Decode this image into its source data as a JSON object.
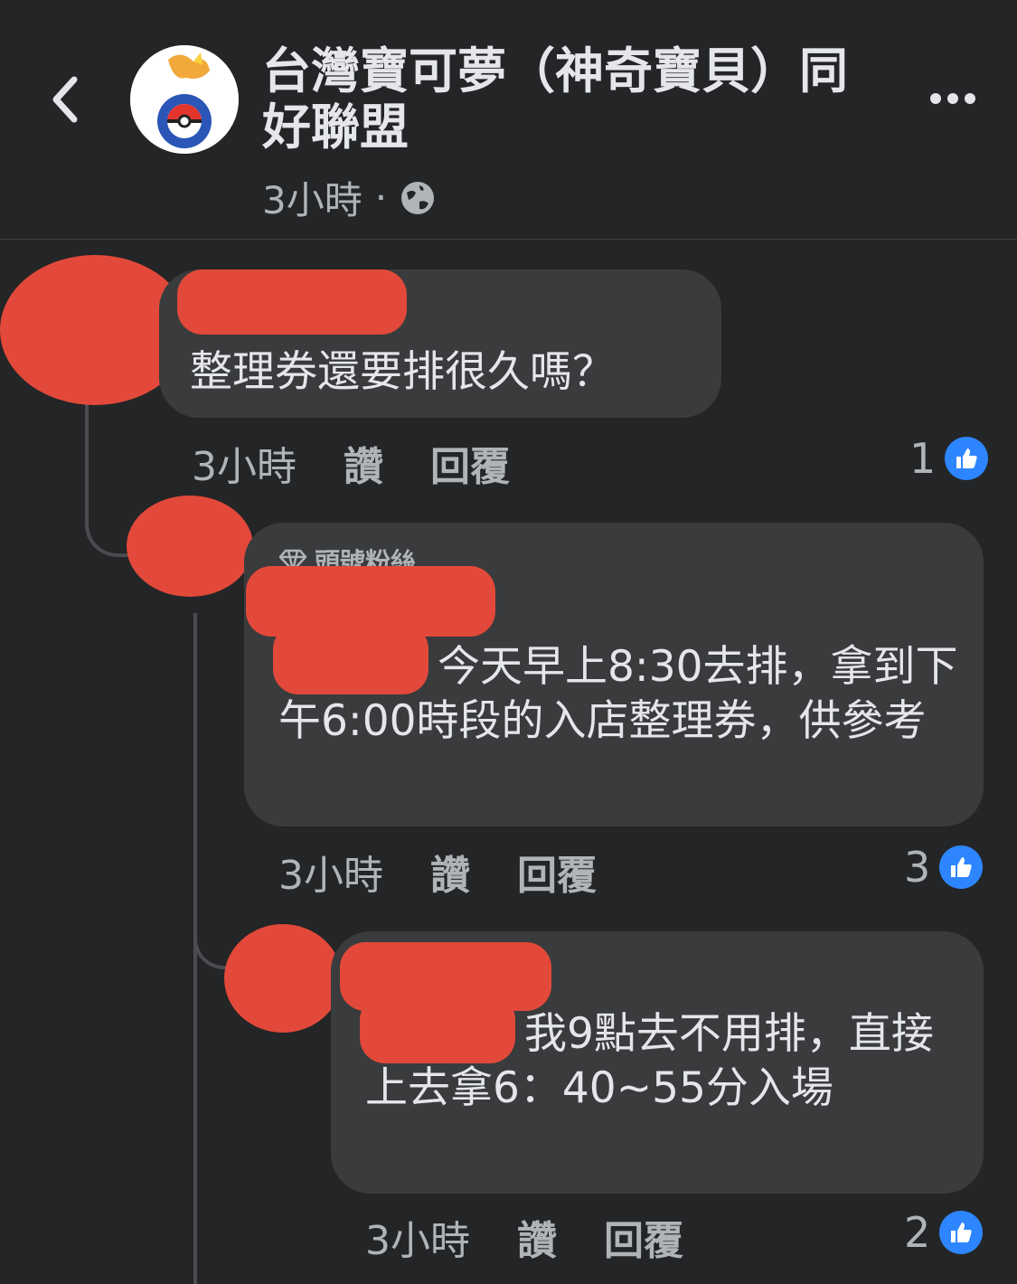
{
  "header": {
    "title": "台灣寶可夢（神奇寶貝）同好聯盟",
    "time": "3小時",
    "separator": "·",
    "back_icon": "chevron-left-icon",
    "privacy_icon": "globe-icon",
    "more_icon": "more-horizontal-icon"
  },
  "comments": [
    {
      "text": "整理券還要排很久嗎？",
      "time": "3小時",
      "like_label": "讚",
      "reply_label": "回覆",
      "likes": "1"
    },
    {
      "badge": "頭號粉絲",
      "text": "今天早上8:30去排，拿到下午6:00時段的入店整理券，供參考",
      "time": "3小時",
      "like_label": "讚",
      "reply_label": "回覆",
      "likes": "3"
    },
    {
      "text": "我9點去不用排，直接上去拿6：40~55分入場",
      "time": "3小時",
      "like_label": "讚",
      "reply_label": "回覆",
      "likes": "2"
    }
  ],
  "colors": {
    "background": "#242526",
    "bubble": "#3a3b3c",
    "like_blue": "#2d86ff",
    "redaction": "#e2493a"
  }
}
